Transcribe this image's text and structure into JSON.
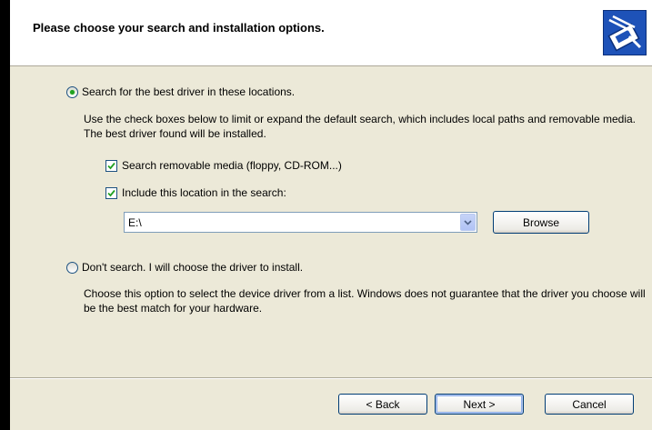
{
  "header": {
    "title": "Please choose your search and installation options.",
    "icon": "hardware-wizard-icon"
  },
  "options": {
    "search": {
      "label": "Search for the best driver in these locations.",
      "selected": true,
      "description": "Use the check boxes below to limit or expand the default search, which includes local paths and removable media. The best driver found will be installed.",
      "removable_media": {
        "label": "Search removable media (floppy, CD-ROM...)",
        "checked": true
      },
      "include_location": {
        "label": "Include this location in the search:",
        "checked": true
      },
      "location_value": "E:\\",
      "browse_label": "Browse"
    },
    "dont_search": {
      "label": "Don't search. I will choose the driver to install.",
      "selected": false,
      "description": "Choose this option to select the device driver from a list.  Windows does not guarantee that the driver you choose will be the best match for your hardware."
    }
  },
  "buttons": {
    "back": "< Back",
    "next": "Next >",
    "cancel": "Cancel"
  },
  "colors": {
    "dialog_bg": "#ece9d8",
    "header_bg": "#ffffff",
    "radio_dot": "#21a121",
    "border_blue": "#003c74"
  }
}
